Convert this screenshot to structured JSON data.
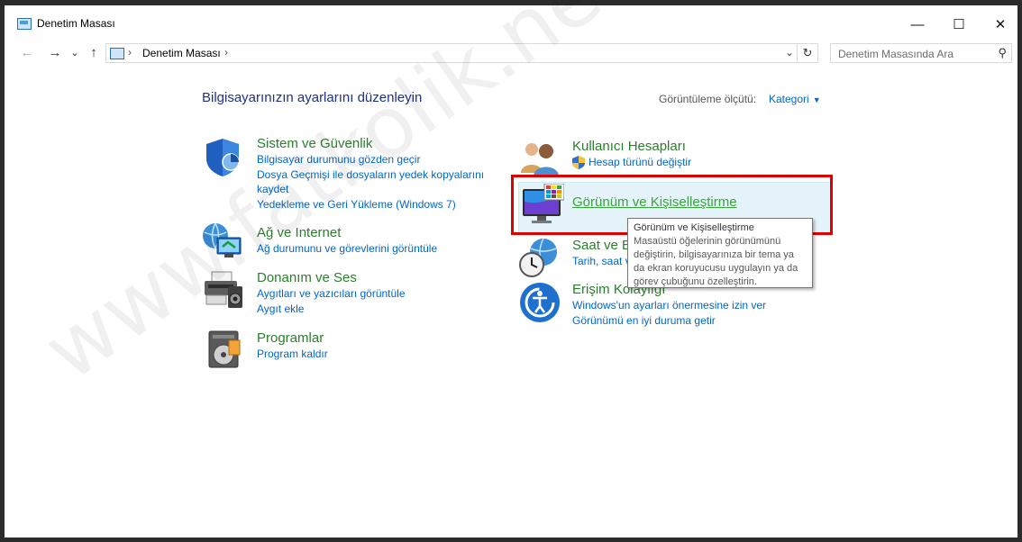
{
  "window": {
    "title": "Denetim Masası",
    "minimize_glyph": "—",
    "maximize_glyph": "☐",
    "close_glyph": "✕"
  },
  "nav": {
    "back_glyph": "←",
    "forward_glyph": "→",
    "recent_glyph": "⌄",
    "up_glyph": "↑"
  },
  "address": {
    "path": "Denetim Masası",
    "separator": "›",
    "dropdown_glyph": "⌄",
    "refresh_glyph": "↻"
  },
  "search": {
    "placeholder": "Denetim Masasında Ara",
    "icon": "search-icon"
  },
  "main": {
    "heading": "Bilgisayarınızın ayarlarını düzenleyin",
    "view_by_label": "Görüntüleme ölçütü:",
    "view_by_value": "Kategori"
  },
  "categories_left": [
    {
      "title": "Sistem ve Güvenlik",
      "icon": "shield-icon",
      "links": [
        "Bilgisayar durumunu gözden geçir",
        "Dosya Geçmişi ile dosyaların yedek kopyalarını",
        "kaydet",
        "Yedekleme ve Geri Yükleme (Windows 7)"
      ]
    },
    {
      "title": "Ağ ve Internet",
      "icon": "network-globe-icon",
      "links": [
        "Ağ durumunu ve görevlerini görüntüle"
      ]
    },
    {
      "title": "Donanım ve Ses",
      "icon": "printer-speaker-icon",
      "links": [
        "Aygıtları ve yazıcıları görüntüle",
        "Aygıt ekle"
      ]
    },
    {
      "title": "Programlar",
      "icon": "programs-disc-icon",
      "links": [
        "Program kaldır"
      ]
    }
  ],
  "categories_right": [
    {
      "title": "Kullanıcı Hesapları",
      "icon": "users-icon",
      "links": [
        "Hesap türünü değiştir"
      ]
    },
    {
      "title": "Görünüm ve Kişiselleştirme",
      "icon": "monitor-palette-icon",
      "links": []
    },
    {
      "title": "Saat ve B",
      "icon": "clock-globe-icon",
      "links": [
        "Tarih, saat v"
      ]
    },
    {
      "title": "Erişim Kolaylığı",
      "icon": "ease-of-access-icon",
      "links": [
        "Windows'un ayarları önermesine izin ver",
        "Görünümü en iyi duruma getir"
      ]
    }
  ],
  "tooltip": {
    "title": "Görünüm ve Kişiselleştirme",
    "lines": [
      "Masaüstü öğelerinin görünümünü",
      "değiştirin, bilgisayarınıza bir tema ya",
      "da ekran koruyucusu uygulayın ya da",
      "görev çubuğunu özelleştirin."
    ]
  },
  "watermark": "www.fatkolik.net",
  "colors": {
    "heading": "#1e3287",
    "category_title": "#2b7e2b",
    "link": "#0066cc",
    "highlight_border": "#e00000"
  }
}
